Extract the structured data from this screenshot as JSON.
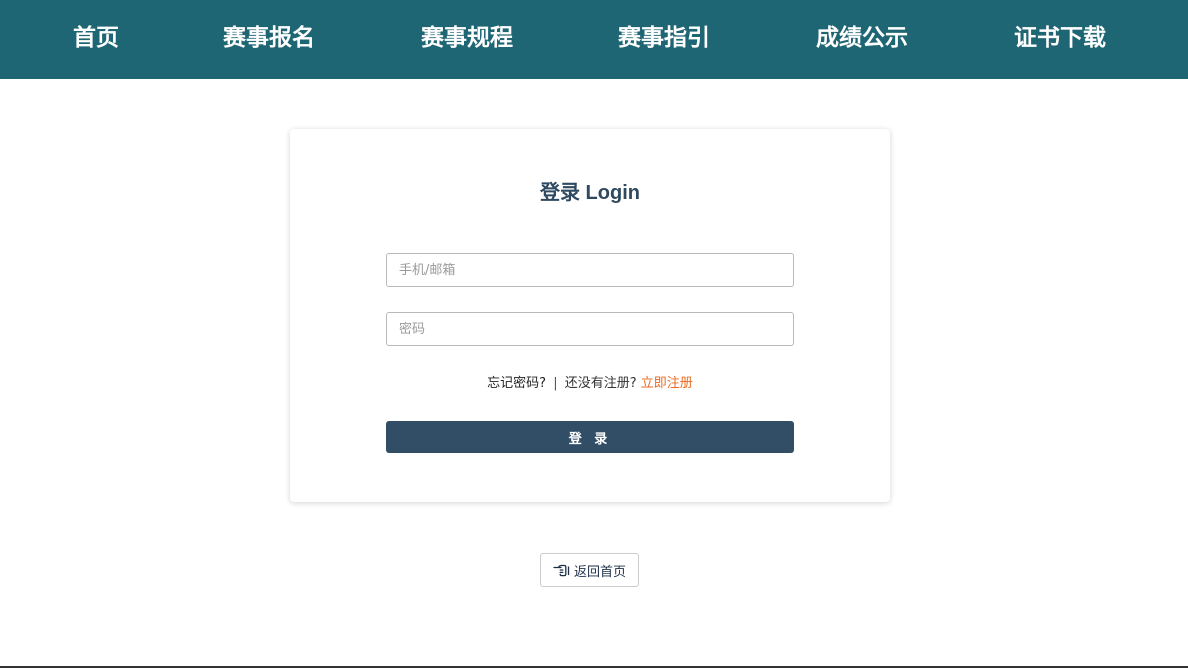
{
  "nav": {
    "items": [
      {
        "label": "首页"
      },
      {
        "label": "赛事报名"
      },
      {
        "label": "赛事规程"
      },
      {
        "label": "赛事指引"
      },
      {
        "label": "成绩公示"
      },
      {
        "label": "证书下载"
      }
    ]
  },
  "login": {
    "title": "登录 Login",
    "account": {
      "placeholder": "手机/邮箱",
      "value": ""
    },
    "password": {
      "placeholder": "密码",
      "value": ""
    },
    "forgot_label": "忘记密码?",
    "separator": "|",
    "no_account_label": "还没有注册?",
    "register_label": "立即注册",
    "submit_label": "登 录"
  },
  "back_home": {
    "label": "返回首页",
    "icon": "pointing-hand-left-icon"
  },
  "colors": {
    "nav_bg": "#1f6674",
    "title": "#2f4a60",
    "button_bg": "#324d66",
    "register_link": "#ec6a1e"
  }
}
